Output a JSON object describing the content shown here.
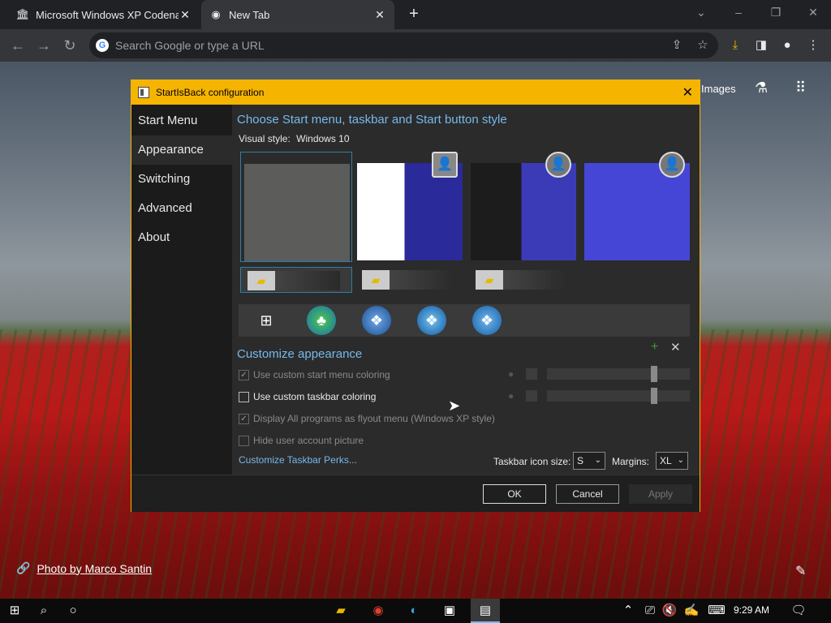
{
  "browser": {
    "tabs": [
      {
        "title": "Microsoft Windows XP Codename"
      },
      {
        "title": "New Tab"
      }
    ],
    "omnibox_placeholder": "Search Google or type a URL"
  },
  "newtab_page": {
    "images_link": "Images",
    "photo_credit": "Photo by Marco Santin"
  },
  "dialog": {
    "title": "StartIsBack configuration",
    "nav": [
      "Start Menu",
      "Appearance",
      "Switching",
      "Advanced",
      "About"
    ],
    "active_nav": "Appearance",
    "heading_style": "Choose Start menu, taskbar and Start button style",
    "visual_style_label": "Visual style:",
    "visual_style_value": "Windows 10",
    "heading_customize": "Customize appearance",
    "checkboxes": [
      {
        "label": "Use custom start menu coloring",
        "checked": true,
        "enabled": false
      },
      {
        "label": "Use custom taskbar coloring",
        "checked": false,
        "enabled": true
      },
      {
        "label": "Display All programs as flyout menu (Windows XP style)",
        "checked": true,
        "enabled": false
      },
      {
        "label": "Hide user account picture",
        "checked": false,
        "enabled": false
      }
    ],
    "perks_link": "Customize Taskbar Perks...",
    "taskbar_icon_size_label": "Taskbar icon size:",
    "taskbar_icon_size_value": "S",
    "margins_label": "Margins:",
    "margins_value": "XL",
    "buttons": {
      "ok": "OK",
      "cancel": "Cancel",
      "apply": "Apply"
    }
  },
  "taskbar": {
    "clock": "9:29 AM"
  },
  "colors": {
    "accent": "#f5b400",
    "link": "#76b9ed"
  }
}
